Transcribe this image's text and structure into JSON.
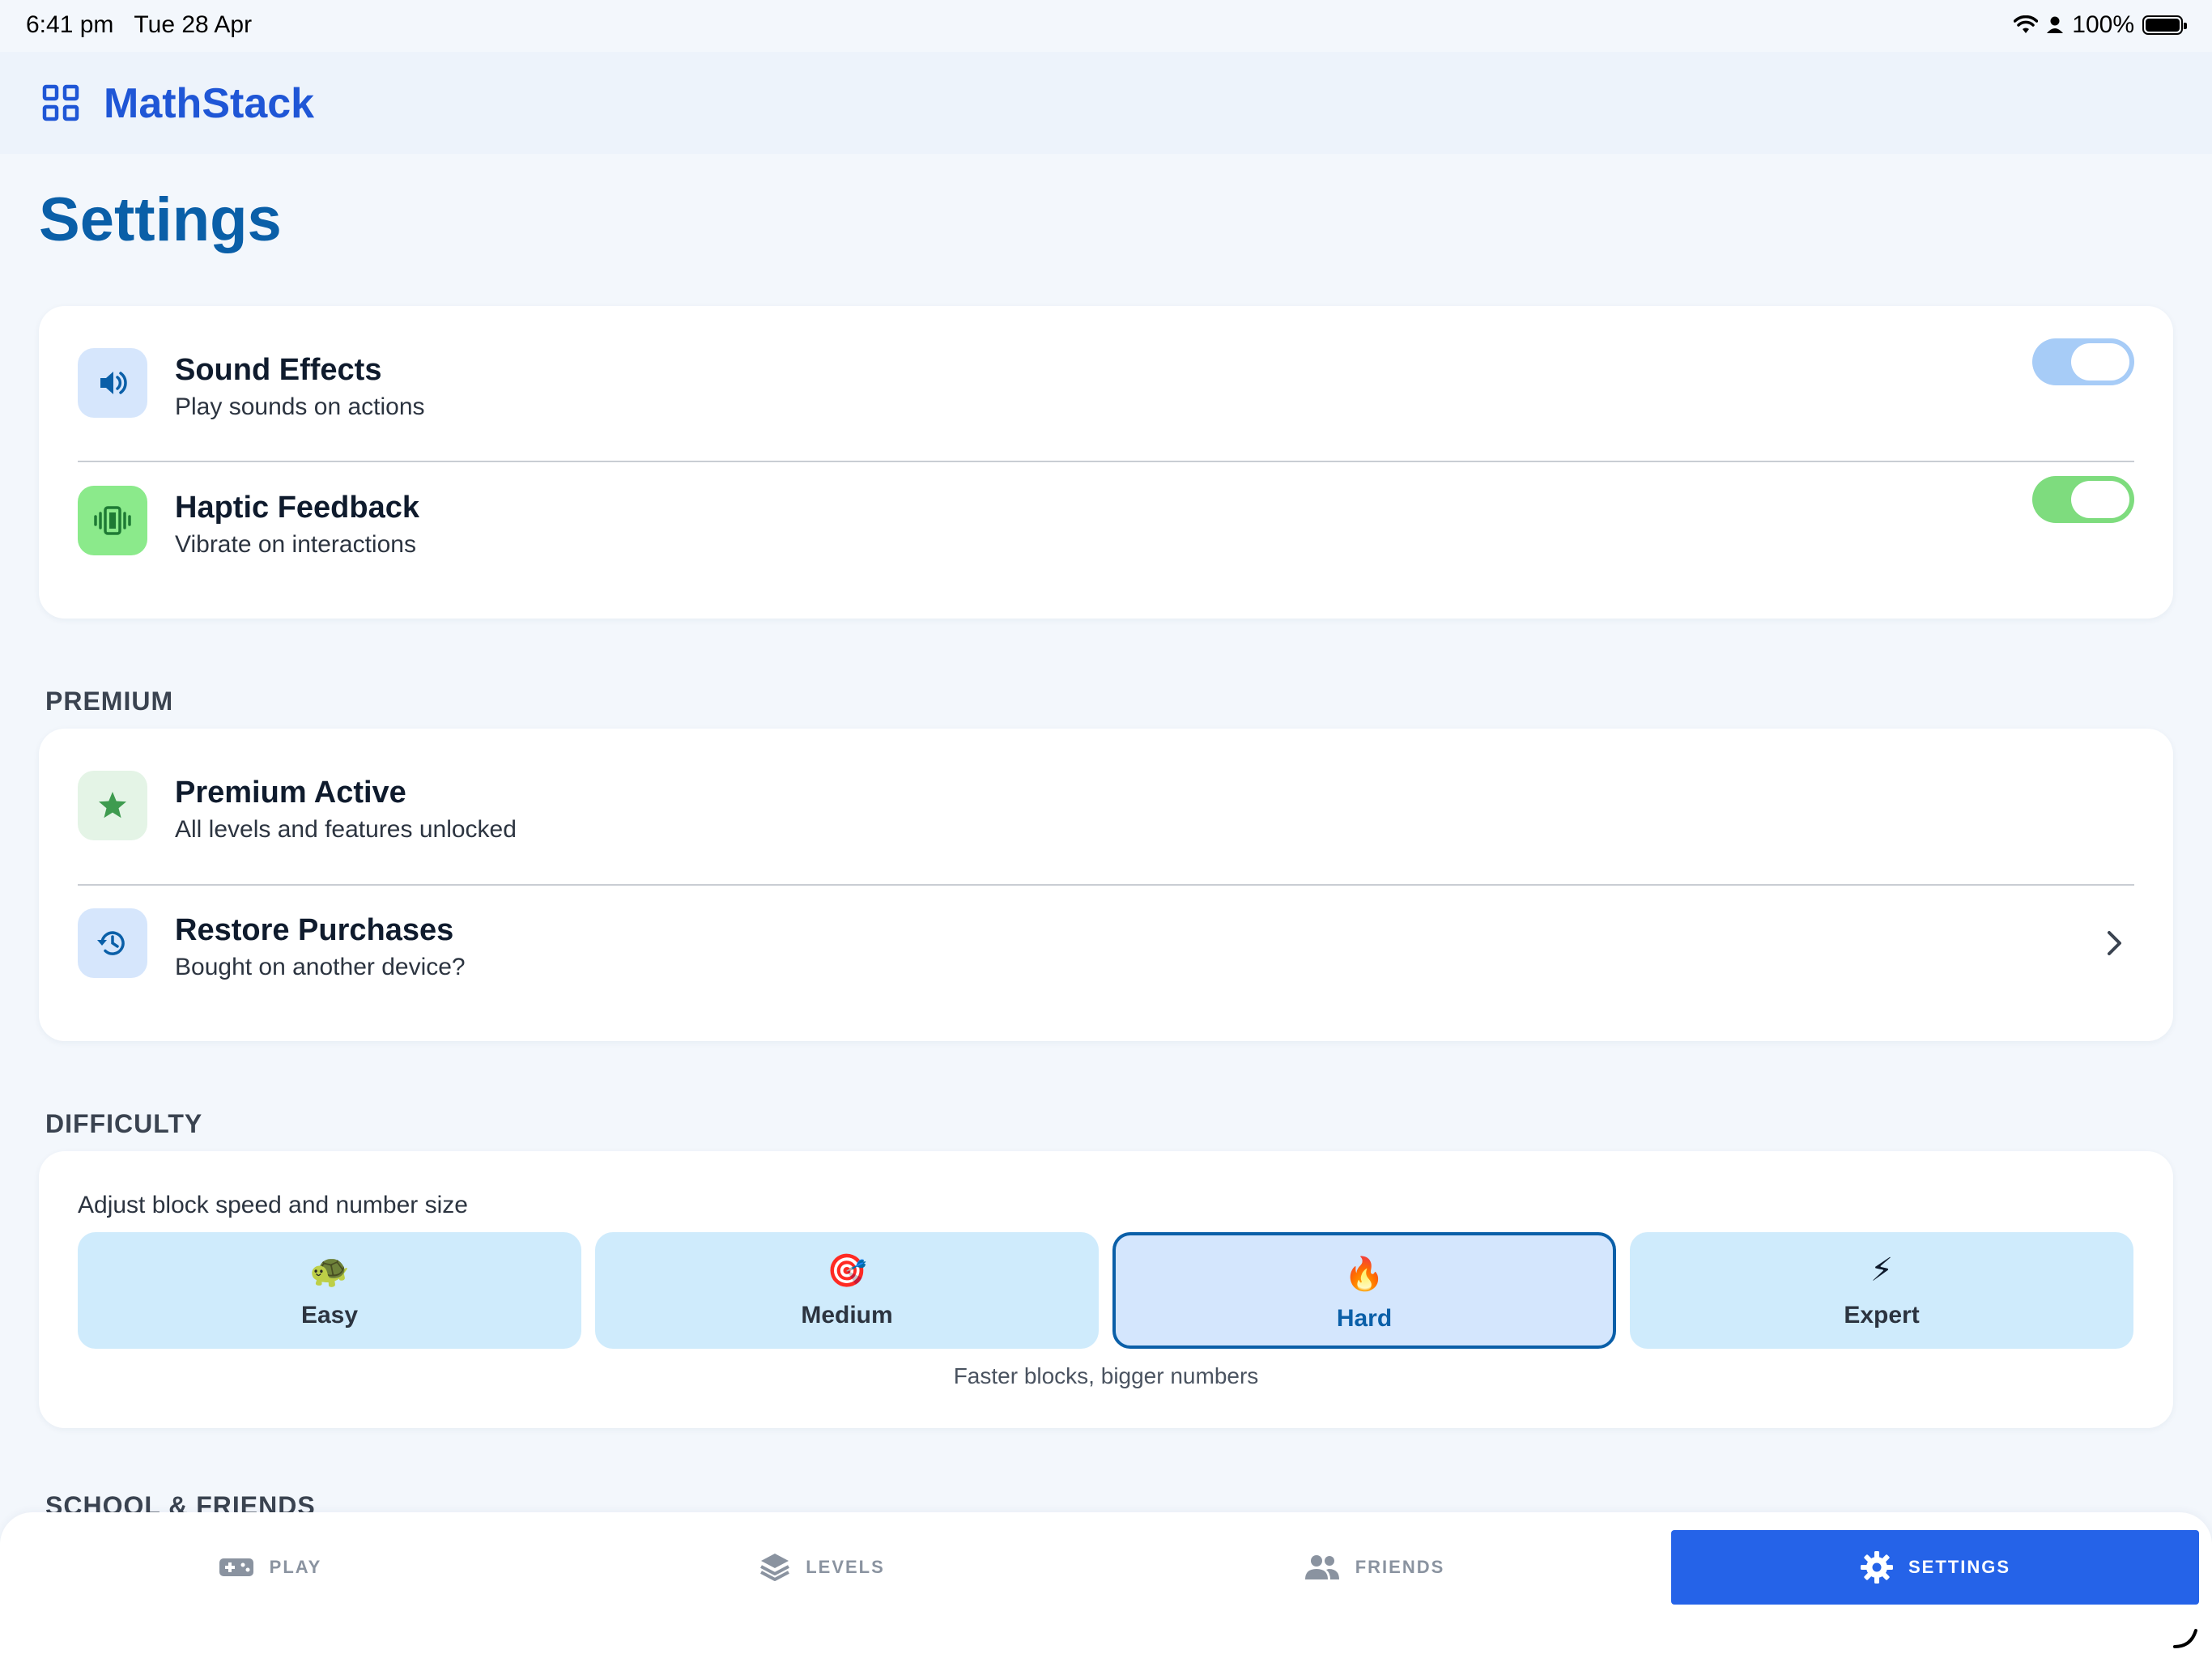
{
  "status_bar": {
    "time": "6:41 pm",
    "date": "Tue 28 Apr",
    "battery": "100%",
    "icons": [
      "wifi-icon",
      "person-icon",
      "battery-icon"
    ]
  },
  "app_bar": {
    "title": "MathStack",
    "icon": "grid-icon"
  },
  "page": {
    "title": "Settings"
  },
  "toggles_card": {
    "rows": [
      {
        "title": "Sound Effects",
        "subtitle": "Play sounds on actions",
        "icon": "speaker-icon",
        "enabled": true,
        "accent": "#A7CCF7"
      },
      {
        "title": "Haptic Feedback",
        "subtitle": "Vibrate on interactions",
        "icon": "vibrate-icon",
        "enabled": true,
        "accent": "#7EDC7E"
      }
    ]
  },
  "premium": {
    "section_label": "PREMIUM",
    "rows": [
      {
        "title": "Premium Active",
        "subtitle": "All levels and features unlocked",
        "icon": "star-icon"
      },
      {
        "title": "Restore Purchases",
        "subtitle": "Bought on another device?",
        "icon": "restore-icon",
        "chevron": "chevron-right-icon"
      }
    ]
  },
  "difficulty": {
    "section_label": "DIFFICULTY",
    "caption": "Adjust block speed and number size",
    "options": [
      {
        "label": "Easy",
        "emoji": "🐢"
      },
      {
        "label": "Medium",
        "emoji": "🎯"
      },
      {
        "label": "Hard",
        "emoji": "🔥"
      },
      {
        "label": "Expert",
        "emoji": "⚡"
      }
    ],
    "selected": "Hard",
    "description": "Faster blocks, bigger numbers"
  },
  "next_section_label": "SCHOOL & FRIENDS",
  "tab_bar": {
    "tabs": [
      {
        "label": "PLAY",
        "icon": "gamepad-icon"
      },
      {
        "label": "LEVELS",
        "icon": "layers-icon"
      },
      {
        "label": "FRIENDS",
        "icon": "people-icon"
      },
      {
        "label": "SETTINGS",
        "icon": "gear-icon"
      }
    ],
    "active": "SETTINGS"
  },
  "colors": {
    "brand": "#1F56D6",
    "title": "#0A5FA8",
    "active_tab": "#2563E8",
    "premium_green": "#3E9B4F"
  }
}
